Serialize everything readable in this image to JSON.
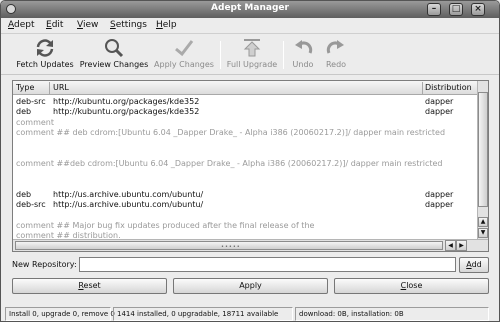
{
  "window": {
    "title": "Adept Manager"
  },
  "menu": [
    {
      "u": "A",
      "rest": "dept"
    },
    {
      "u": "E",
      "rest": "dit"
    },
    {
      "u": "V",
      "rest": "iew"
    },
    {
      "u": "S",
      "rest": "ettings"
    },
    {
      "u": "H",
      "rest": "elp"
    }
  ],
  "toolbar": {
    "fetch": "Fetch Updates",
    "preview": "Preview Changes",
    "apply": "Apply Changes",
    "full_upgrade": "Full Upgrade",
    "undo": "Undo",
    "redo": "Redo"
  },
  "table": {
    "headers": {
      "type": "Type",
      "url": "URL",
      "distribution": "Distribution"
    },
    "rows": [
      {
        "type": "deb-src",
        "url": "http://kubuntu.org/packages/kde352",
        "dist": "dapper",
        "comment": false
      },
      {
        "type": "deb",
        "url": "http://kubuntu.org/packages/kde352",
        "dist": "dapper",
        "comment": false
      },
      {
        "type": "comment",
        "url": "",
        "dist": "",
        "comment": true
      },
      {
        "type": "",
        "url": "comment ## deb cdrom:[Ubuntu 6.04 _Dapper Drake_ - Alpha i386 (20060217.2)]/ dapper main restricted",
        "dist": "",
        "comment": true
      },
      {
        "type": "",
        "url": "",
        "dist": "",
        "comment": true
      },
      {
        "type": "",
        "url": "",
        "dist": "",
        "comment": true
      },
      {
        "type": "",
        "url": "comment ##deb cdrom:[Ubuntu 6.04 _Dapper Drake_ - Alpha i386 (20060217.2)]/ dapper main restricted",
        "dist": "",
        "comment": true
      },
      {
        "type": "",
        "url": "",
        "dist": "",
        "comment": true
      },
      {
        "type": "",
        "url": "",
        "dist": "",
        "comment": true
      },
      {
        "type": "deb",
        "url": "http://us.archive.ubuntu.com/ubuntu/",
        "dist": "dapper",
        "comment": false
      },
      {
        "type": "deb-src",
        "url": "http://us.archive.ubuntu.com/ubuntu/",
        "dist": "dapper",
        "comment": false
      },
      {
        "type": "",
        "url": "",
        "dist": "",
        "comment": true
      },
      {
        "type": "",
        "url": "comment ## Major bug fix updates produced after the final release of the",
        "dist": "",
        "comment": true
      },
      {
        "type": "",
        "url": "comment ## distribution.",
        "dist": "",
        "comment": true
      }
    ]
  },
  "new_repo": {
    "label": "New Repository:",
    "value": "",
    "add_u": "A",
    "add_rest": "dd"
  },
  "actions": {
    "reset_u": "R",
    "reset_rest": "eset",
    "apply": "Apply",
    "close_u": "C",
    "close_rest": "lose"
  },
  "status": {
    "summary": "Install 0, upgrade 0, remove 0",
    "counts": "1414 installed, 0 upgradable, 18711 available",
    "download": "download: 0B, installation: 0B"
  }
}
